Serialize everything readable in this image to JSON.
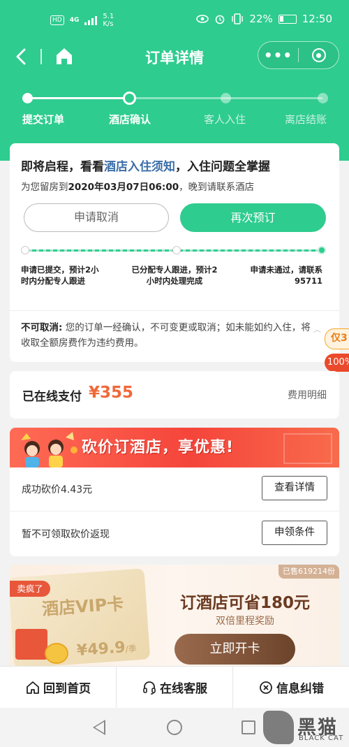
{
  "status_bar": {
    "network_badge": "HD",
    "network_type": "4G",
    "speed_value": "5.1",
    "speed_unit": "K/s",
    "battery": "22%",
    "time": "12:50"
  },
  "nav": {
    "title": "订单详情",
    "more_label": "•••"
  },
  "progress": {
    "current_index": 1,
    "steps": [
      "提交订单",
      "酒店确认",
      "客人入住",
      "离店结账"
    ]
  },
  "notice_card": {
    "title_before": "即将启程，看看",
    "title_highlight": "酒店入住须知",
    "title_after": "，入住问题全掌握",
    "subtitle_before": "为您留房到",
    "subtitle_datetime": "2020年03月07日06:00",
    "subtitle_after": "，晚到请联系酒店",
    "cancel_button": "申请取消",
    "rebook_button": "再次预订",
    "cancel_steps": [
      "申请已提交，预计2小时内分配专人跟进",
      "已分配专人跟进，预计2小时内处理完成",
      "申请未通过，请联系95711"
    ],
    "policy_label": "不可取消:",
    "policy_text": " 您的订单一经确认，不可变更或取消；如未能如约入住，将收取全额房费作为违约费用。"
  },
  "side_tag": {
    "line1": "仅3",
    "line2": "100%"
  },
  "payment": {
    "label": "已在线支付",
    "amount": "¥355",
    "detail_link": "费用明细"
  },
  "bargain": {
    "banner_text": "砍价订酒店，享优惠!",
    "rows": [
      {
        "text": "成功砍价4.43元",
        "button": "查看详情"
      },
      {
        "text": "暂不可领取砍价返现",
        "button": "申领条件"
      }
    ]
  },
  "vip": {
    "sold_badge": "已售619214份",
    "crazy_tag": "卖疯了",
    "card_title": "酒店VIP卡",
    "card_price": "¥49.9",
    "card_price_unit": "/季",
    "headline": "订酒店可省180元",
    "subheadline": "双倍里程奖励",
    "cta": "立即开卡"
  },
  "bottom_bar": {
    "home": "回到首页",
    "service": "在线客服",
    "correction": "信息纠错"
  },
  "watermark": {
    "text": "黑猫",
    "sub": "BLACK CAT"
  },
  "colors": {
    "brand_green": "#2ecc8f",
    "price_orange": "#f0693a",
    "link_blue": "#3a6ea8"
  }
}
